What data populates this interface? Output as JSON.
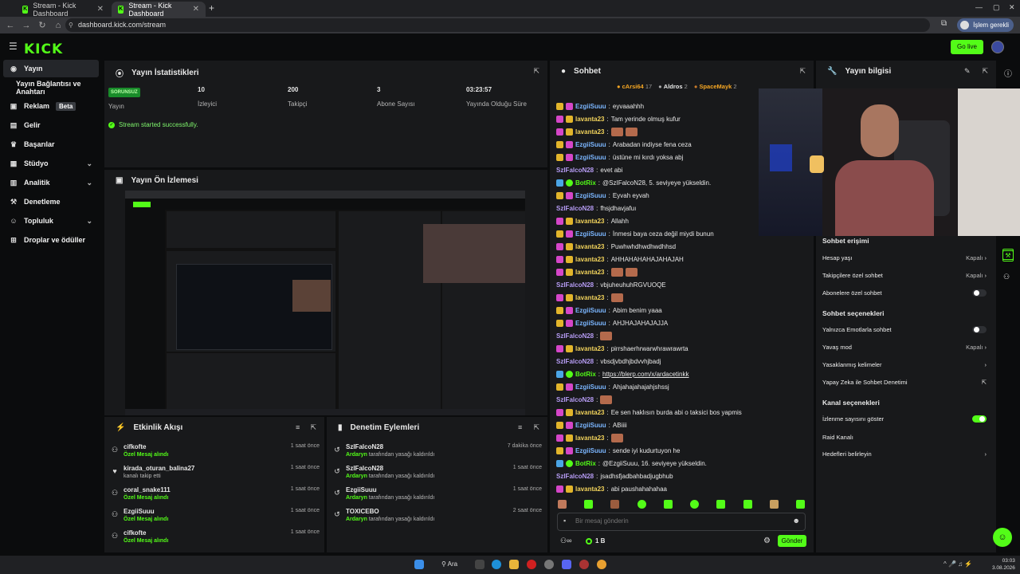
{
  "browser": {
    "tabs": [
      {
        "title": "Stream - Kick Dashboard"
      },
      {
        "title": "Stream - Kick Dashboard"
      }
    ],
    "url": "dashboard.kick.com/stream",
    "profile_label": "İşlem gerekli"
  },
  "header": {
    "logo": "KICK",
    "go_live": "Go live"
  },
  "sidebar": {
    "items": [
      {
        "label": "Yayın"
      },
      {
        "label": "Yayın Bağlantısı ve Anahtarı"
      },
      {
        "label": "Reklam",
        "badge": "Beta"
      },
      {
        "label": "Gelir"
      },
      {
        "label": "Başarılar"
      },
      {
        "label": "Stüdyo"
      },
      {
        "label": "Analitik"
      },
      {
        "label": "Denetleme"
      },
      {
        "label": "Topluluk"
      },
      {
        "label": "Droplar ve ödüller"
      }
    ]
  },
  "stats": {
    "title": "Yayın İstatistikleri",
    "status_badge": "SORUNSUZ",
    "status_label": "Yayın",
    "viewers": "10",
    "viewers_label": "İzleyici",
    "followers": "200",
    "followers_label": "Takipçi",
    "subs": "3",
    "subs_label": "Abone Sayısı",
    "uptime": "03:23:57",
    "uptime_label": "Yayında Olduğu Süre",
    "message": "Stream started successfully."
  },
  "preview": {
    "title": "Yayın Ön İzlemesi"
  },
  "activity": {
    "title": "Etkinlik Akışı",
    "items": [
      {
        "name": "cifkofte",
        "sub": "Özel Mesaj alındı",
        "time": "1 saat önce"
      },
      {
        "name": "kirada_oturan_balina27",
        "sub": "kanalı takip etti",
        "time": "1 saat önce"
      },
      {
        "name": "coral_snake111",
        "sub": "Özel Mesaj alındı",
        "time": "1 saat önce"
      },
      {
        "name": "EzgiiSuuu",
        "sub": "Özel Mesaj alındı",
        "time": "1 saat önce"
      },
      {
        "name": "cifkofte",
        "sub": "Özel Mesaj alındı",
        "time": "1 saat önce"
      }
    ]
  },
  "moderation": {
    "title": "Denetim Eylemleri",
    "items": [
      {
        "name": "SzIFalcoN28",
        "actor": "Ardaryn",
        "sub": "tarafından yasağı kaldırıldı",
        "time": "7 dakika önce"
      },
      {
        "name": "SzIFalcoN28",
        "actor": "Ardaryn",
        "sub": "tarafından yasağı kaldırıldı",
        "time": "1 saat önce"
      },
      {
        "name": "EzgiiSuuu",
        "actor": "Ardaryn",
        "sub": "tarafından yasağı kaldırıldı",
        "time": "1 saat önce"
      },
      {
        "name": "TOXICEBO",
        "actor": "Ardaryn",
        "sub": "tarafından yasağı kaldırıldı",
        "time": "2 saat önce"
      }
    ]
  },
  "chat": {
    "title": "Sohbet",
    "top_gifters": [
      {
        "name": "cArsi64",
        "count": "17"
      },
      {
        "name": "Aldros",
        "count": "2"
      },
      {
        "name": "SpaceMayk",
        "count": "2"
      }
    ],
    "messages": [
      {
        "user": "EzgiiSuuu",
        "color": "c-blue",
        "text": "eyvaaahhh",
        "badges": [
          "gift",
          "sub"
        ]
      },
      {
        "user": "lavanta23",
        "color": "c-yellow",
        "text": "Tam yerinde olmuş kufur",
        "badges": [
          "sub",
          "gift"
        ]
      },
      {
        "user": "lavanta23",
        "color": "c-yellow",
        "text": "",
        "badges": [
          "sub",
          "gift"
        ],
        "emotes": 2
      },
      {
        "user": "EzgiiSuuu",
        "color": "c-blue",
        "text": "Arabadan indiyse fena ceza",
        "badges": [
          "gift",
          "sub"
        ]
      },
      {
        "user": "EzgiiSuuu",
        "color": "c-blue",
        "text": "üstüne mi kırdı yoksa abj",
        "badges": [
          "gift",
          "sub"
        ]
      },
      {
        "user": "SzIFalcoN28",
        "color": "c-purple",
        "text": "evet abi",
        "badges": []
      },
      {
        "user": "BotRix",
        "color": "c-green",
        "text": "@SzIFalcoN28, 5. seviyeye yükseldin.",
        "badges": [
          "bot",
          "ver"
        ]
      },
      {
        "user": "EzgiiSuuu",
        "color": "c-blue",
        "text": "Eyvah eyvah",
        "badges": [
          "gift",
          "sub"
        ]
      },
      {
        "user": "SzIFalcoN28",
        "color": "c-purple",
        "text": "fhsjdhavjafuı",
        "badges": []
      },
      {
        "user": "lavanta23",
        "color": "c-yellow",
        "text": "Allahh",
        "badges": [
          "sub",
          "gift"
        ]
      },
      {
        "user": "EzgiiSuuu",
        "color": "c-blue",
        "text": "İnmesi baya ceza değil miydi bunun",
        "badges": [
          "gift",
          "sub"
        ]
      },
      {
        "user": "lavanta23",
        "color": "c-yellow",
        "text": "Puwhwhdhwdhwdhhsd",
        "badges": [
          "sub",
          "gift"
        ]
      },
      {
        "user": "lavanta23",
        "color": "c-yellow",
        "text": "AHHAHAHAHAJAHAJAH",
        "badges": [
          "sub",
          "gift"
        ]
      },
      {
        "user": "lavanta23",
        "color": "c-yellow",
        "text": "",
        "badges": [
          "sub",
          "gift"
        ],
        "emotes": 2
      },
      {
        "user": "SzIFalcoN28",
        "color": "c-purple",
        "text": "vbjuheuhuhRGVUOQE",
        "badges": []
      },
      {
        "user": "lavanta23",
        "color": "c-yellow",
        "text": "",
        "badges": [
          "sub",
          "gift"
        ],
        "emotes": 1
      },
      {
        "user": "EzgiiSuuu",
        "color": "c-blue",
        "text": "Abim benim yaaa",
        "badges": [
          "gift",
          "sub"
        ]
      },
      {
        "user": "EzgiiSuuu",
        "color": "c-blue",
        "text": "AHJHAJAHAJAJJA",
        "badges": [
          "gift",
          "sub"
        ]
      },
      {
        "user": "SzIFalcoN28",
        "color": "c-purple",
        "text": "",
        "badges": [],
        "emotes": 1
      },
      {
        "user": "lavanta23",
        "color": "c-yellow",
        "text": "pirrshaerhrwarwhrawrawrta",
        "badges": [
          "sub",
          "gift"
        ]
      },
      {
        "user": "SzIFalcoN28",
        "color": "c-purple",
        "text": "vbsdjvbdhjbdvvhjbadj",
        "badges": []
      },
      {
        "user": "BotRix",
        "color": "c-green",
        "text": "https://blerp.com/x/ardacetinkk",
        "badges": [
          "bot",
          "ver"
        ]
      },
      {
        "user": "EzgiiSuuu",
        "color": "c-blue",
        "text": "Ahjahajahajahjshssj",
        "badges": [
          "gift",
          "sub"
        ]
      },
      {
        "user": "SzIFalcoN28",
        "color": "c-purple",
        "text": "",
        "badges": [],
        "emotes": 1
      },
      {
        "user": "lavanta23",
        "color": "c-yellow",
        "text": "Ee sen haklısın burda abi o taksici bos yapmis",
        "badges": [
          "sub",
          "gift"
        ]
      },
      {
        "user": "EzgiiSuuu",
        "color": "c-blue",
        "text": "ABiiii",
        "badges": [
          "gift",
          "sub"
        ]
      },
      {
        "user": "lavanta23",
        "color": "c-yellow",
        "text": "",
        "badges": [
          "sub",
          "gift"
        ],
        "emotes": 1
      },
      {
        "user": "EzgiiSuuu",
        "color": "c-blue",
        "text": "sende iyi kudurtuyon he",
        "badges": [
          "gift",
          "sub"
        ]
      },
      {
        "user": "BotRix",
        "color": "c-green",
        "text": "@EzgiiSuuu, 16. seviyeye yükseldin.",
        "badges": [
          "bot",
          "ver"
        ]
      },
      {
        "user": "SzIFalcoN28",
        "color": "c-purple",
        "text": "jsadhsfjadbahbadjugbhub",
        "badges": []
      },
      {
        "user": "lavanta23",
        "color": "c-yellow",
        "text": "abi paushahahahaa",
        "badges": [
          "sub",
          "gift"
        ]
      }
    ],
    "input_placeholder": "Bir mesaj gönderin",
    "points": "1 B",
    "send": "Gönder"
  },
  "info": {
    "title": "Yayın bilgisi",
    "chat_access": "Sohbet erişimi",
    "rows1": [
      {
        "label": "Hesap yaşı",
        "value": "Kapalı",
        "kind": "chevron"
      },
      {
        "label": "Takipçilere özel sohbet",
        "value": "Kapalı",
        "kind": "chevron"
      },
      {
        "label": "Abonelere özel sohbet",
        "value": "",
        "kind": "off"
      }
    ],
    "chat_options": "Sohbet seçenekleri",
    "rows2": [
      {
        "label": "Yalnızca Emotlarla sohbet",
        "value": "",
        "kind": "off"
      },
      {
        "label": "Yavaş mod",
        "value": "Kapalı",
        "kind": "chevron"
      },
      {
        "label": "Yasaklanmış kelimeler",
        "value": "",
        "kind": "chevron"
      },
      {
        "label": "Yapay Zeka ile Sohbet Denetimi",
        "value": "",
        "kind": "ext"
      }
    ],
    "channel_options": "Kanal seçenekleri",
    "rows3": [
      {
        "label": "İzlenme sayısını göster",
        "value": "",
        "kind": "on"
      },
      {
        "label": "Raid Kanalı",
        "value": "",
        "kind": "none"
      },
      {
        "label": "Hedefleri belirleyin",
        "value": "",
        "kind": "chevron"
      }
    ]
  },
  "taskbar": {
    "search": "Ara",
    "time": "03:03",
    "date": "3.08.2026"
  }
}
